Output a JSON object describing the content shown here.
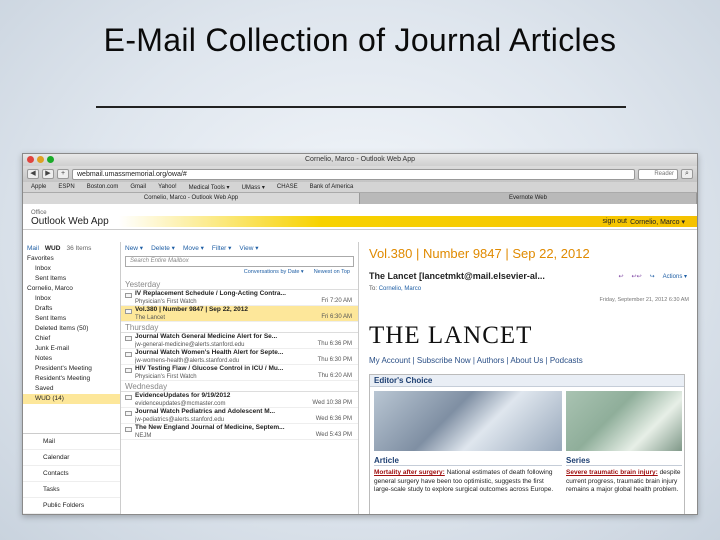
{
  "slide": {
    "title": "E-Mail Collection of Journal Articles"
  },
  "window": {
    "title": "Cornelio, Marco - Outlook Web App",
    "url": "webmail.umassmemorial.org/owa/#",
    "reader": "Reader",
    "bookmarks": [
      "Apple",
      "ESPN",
      "Boston.com",
      "Gmail",
      "Yahoo!",
      "Medical Tools ▾",
      "UMass ▾",
      "CHASE",
      "Bank of America"
    ],
    "tabs": [
      "Cornelio, Marco - Outlook Web App",
      "Evernote Web"
    ]
  },
  "owa": {
    "logo": "Outlook Web App",
    "logo_vendor": "Office",
    "signout": "sign out",
    "user": "Cornelio, Marco ▾"
  },
  "nav": {
    "top": [
      "Mail",
      "WUD",
      "36 Items"
    ],
    "favorites": "Favorites",
    "fav_items": [
      "Inbox",
      "Sent Items"
    ],
    "mailbox": "Cornelio, Marco",
    "folders": [
      "Inbox",
      "Drafts",
      "Sent Items",
      "Deleted Items (50)",
      "Chief",
      "Junk E-mail",
      "Notes",
      "President's Meeting",
      "Resident's Meeting",
      "Saved",
      "WUD (14)"
    ],
    "bottom": [
      "Mail",
      "Calendar",
      "Contacts",
      "Tasks",
      "Public Folders"
    ]
  },
  "list": {
    "tools": [
      "New ▾",
      "Delete ▾",
      "Move ▾",
      "Filter ▾",
      "View ▾"
    ],
    "search_placeholder": "Search Entire Mailbox",
    "sort": [
      "Conversations by Date ▾",
      "Newest on Top"
    ],
    "groups": [
      "Yesterday",
      "Thursday",
      "Wednesday"
    ],
    "messages": [
      {
        "subject": "IV Replacement Schedule / Long-Acting Contra...",
        "from": "Physician's First Watch",
        "time": "Fri 7:20 AM"
      },
      {
        "subject": "Vol.380 | Number 9847 | Sep 22, 2012",
        "from": "The Lancet",
        "time": "Fri 6:30 AM"
      },
      {
        "subject": "Journal Watch General Medicine Alert for Se...",
        "from": "jw-general-medicine@alerts.stanford.edu",
        "time": "Thu 6:36 PM"
      },
      {
        "subject": "Journal Watch Women's Health Alert for Septe...",
        "from": "jw-womens-health@alerts.stanford.edu",
        "time": "Thu 6:30 PM"
      },
      {
        "subject": "HIV Testing Flaw / Glucose Control in ICU / Mu...",
        "from": "Physician's First Watch",
        "time": "Thu 6:20 AM"
      },
      {
        "subject": "EvidenceUpdates for 9/19/2012",
        "from": "evidenceupdates@mcmaster.com",
        "time": "Wed 10:38 PM"
      },
      {
        "subject": "Journal Watch Pediatrics and Adolescent M...",
        "from": "jw-pediatrics@alerts.stanford.edu",
        "time": "Wed 6:36 PM"
      },
      {
        "subject": "The New England Journal of Medicine, Septem...",
        "from": "NEJM",
        "time": "Wed 5:43 PM"
      }
    ]
  },
  "reading": {
    "subject": "Vol.380 | Number 9847 | Sep 22, 2012",
    "sender": "The Lancet [lancetmkt@mail.elsevier-al...",
    "to_label": "To:",
    "to": "Cornelio, Marco",
    "date": "Friday, September 21, 2012 6:30 AM",
    "actions": "Actions ▾",
    "masthead": "THE LANCET",
    "links": "My Account | Subscribe Now | Authors | About Us | Podcasts",
    "editor_choice": "Editor's Choice",
    "article_head": "Article",
    "article_link": "Mortality after surgery:",
    "article_text": " National estimates of death following general surgery have been too optimistic, suggests the first large-scale study to explore surgical outcomes across Europe.",
    "series_head": "Series",
    "series_link": "Severe traumatic brain injury:",
    "series_text": " despite current progress, traumatic brain injury remains a major global health problem."
  },
  "colors": {
    "accent": "#f5c200",
    "selected": "#fde79a",
    "subject": "#e08a00",
    "link": "#1f5fa5"
  }
}
